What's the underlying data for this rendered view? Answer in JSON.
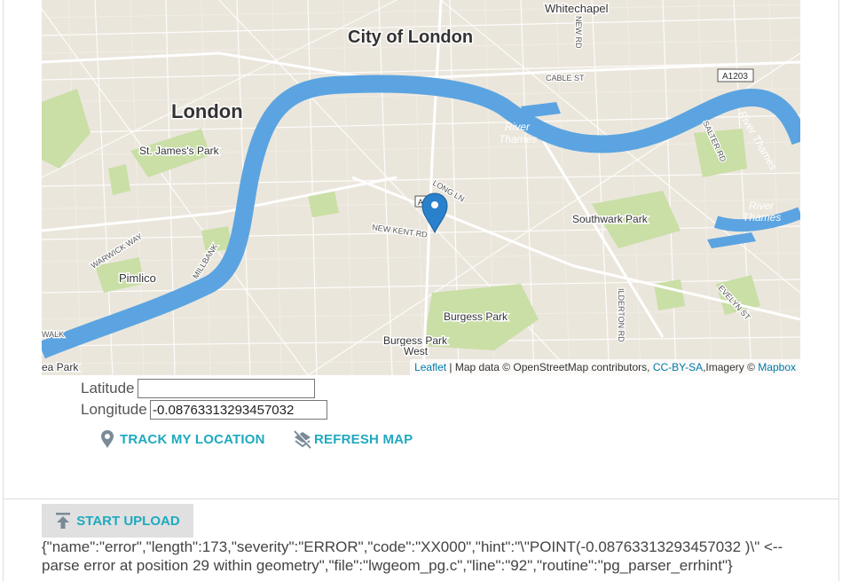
{
  "map": {
    "places": {
      "city": "City of London",
      "london": "London",
      "whitechapel": "Whitechapel",
      "stjames": "St. James's Park",
      "pimlico": "Pimlico",
      "southwark": "Southwark Park",
      "burgess": "Burgess Park",
      "burgess_west": "Burgess Park",
      "burgess_west2": "West",
      "river_thames_1": "River",
      "river_thames_1b": "Thames",
      "river_thames_2": "River",
      "river_thames_2b": "Thames",
      "river_thames_3": "River Thames",
      "cable_st": "CABLE ST",
      "a1203": "A1203",
      "long_ln": "LONG LN",
      "new_kent": "NEW KENT RD",
      "warwick": "WARWICK WAY",
      "millbank": "MILLBANK",
      "new_rd": "NEW RD",
      "salter": "SALTER RD",
      "evelyn": "EVELYN ST",
      "walk": "WALK",
      "park": "ea Park",
      "ilderton": "ILDERTON RD",
      "a_badge": "A"
    },
    "attribution": {
      "leaflet": "Leaflet",
      "middle": " | Map data © OpenStreetMap contributors, ",
      "license": "CC-BY-SA",
      "imagery": ",Imagery © ",
      "mapbox": "Mapbox"
    }
  },
  "form": {
    "latitude_label": "Latitude",
    "latitude_value": "",
    "longitude_label": "Longitude",
    "longitude_value": "-0.08763313293457032"
  },
  "actions": {
    "track_label": "TRACK MY LOCATION",
    "refresh_label": "REFRESH MAP",
    "upload_label": "START UPLOAD"
  },
  "response": {
    "error_text": "{\"name\":\"error\",\"length\":173,\"severity\":\"ERROR\",\"code\":\"XX000\",\"hint\":\"\\\"POINT(-0.08763313293457032 )\\\" <-- parse error at position 29 within geometry\",\"file\":\"lwgeom_pg.c\",\"line\":\"92\",\"routine\":\"pg_parser_errhint\"}"
  },
  "colors": {
    "accent": "#1fa9bf",
    "river": "#5ba4e1",
    "map_bg": "#e9e4da",
    "marker": "#2a81cb"
  }
}
